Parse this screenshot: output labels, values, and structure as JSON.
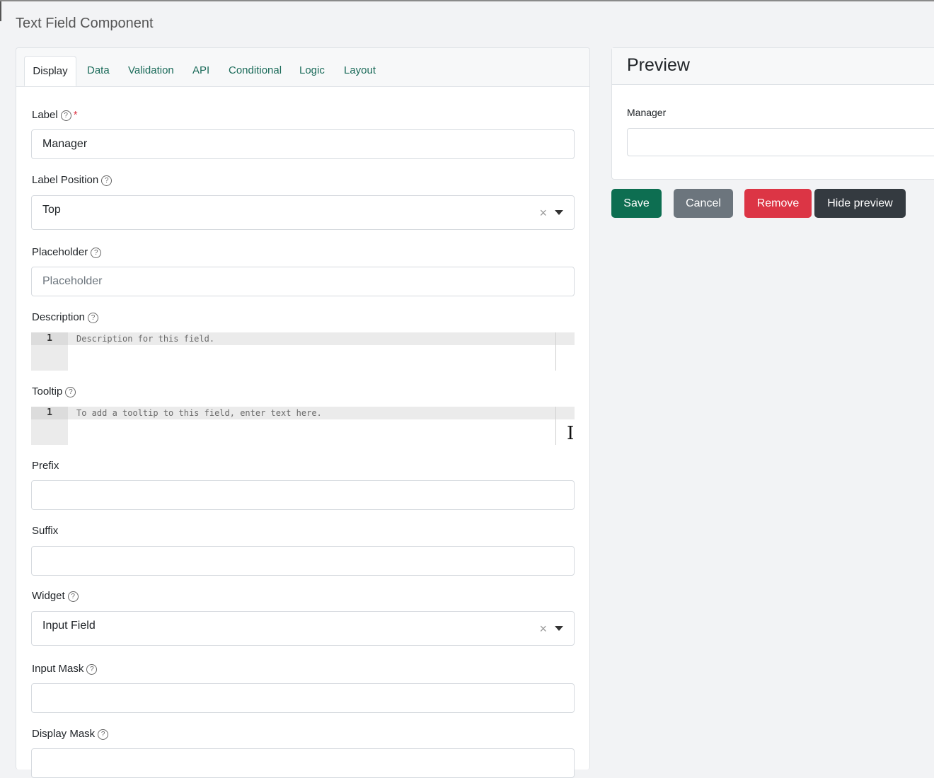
{
  "dialog": {
    "title": "Text Field Component"
  },
  "tabs": [
    {
      "label": "Display",
      "active": true
    },
    {
      "label": "Data"
    },
    {
      "label": "Validation"
    },
    {
      "label": "API"
    },
    {
      "label": "Conditional"
    },
    {
      "label": "Logic"
    },
    {
      "label": "Layout"
    }
  ],
  "fields": {
    "label": {
      "label": "Label",
      "required_mark": "*",
      "value": "Manager"
    },
    "label_position": {
      "label": "Label Position",
      "value": "Top",
      "clear": "×"
    },
    "placeholder": {
      "label": "Placeholder",
      "placeholder": "Placeholder"
    },
    "description": {
      "label": "Description",
      "line_number": "1",
      "placeholder": "Description for this field."
    },
    "tooltip": {
      "label": "Tooltip",
      "line_number": "1",
      "placeholder": "To add a tooltip to this field, enter text here."
    },
    "prefix": {
      "label": "Prefix",
      "value": ""
    },
    "suffix": {
      "label": "Suffix",
      "value": ""
    },
    "widget": {
      "label": "Widget",
      "value": "Input Field",
      "clear": "×"
    },
    "input_mask": {
      "label": "Input Mask",
      "value": ""
    },
    "display_mask": {
      "label": "Display Mask",
      "value": ""
    }
  },
  "help_icon": {
    "glyph": "?",
    "icon": "question-circle-icon"
  },
  "preview": {
    "title": "Preview",
    "field_label": "Manager",
    "field_value": ""
  },
  "buttons": {
    "save": "Save",
    "cancel": "Cancel",
    "remove": "Remove",
    "hide_preview": "Hide preview"
  },
  "colors": {
    "save": "#0d6e51",
    "cancel": "#6c757d",
    "remove": "#dc3545",
    "hide_preview": "#343a40",
    "tab_link": "#1b6b5a"
  }
}
